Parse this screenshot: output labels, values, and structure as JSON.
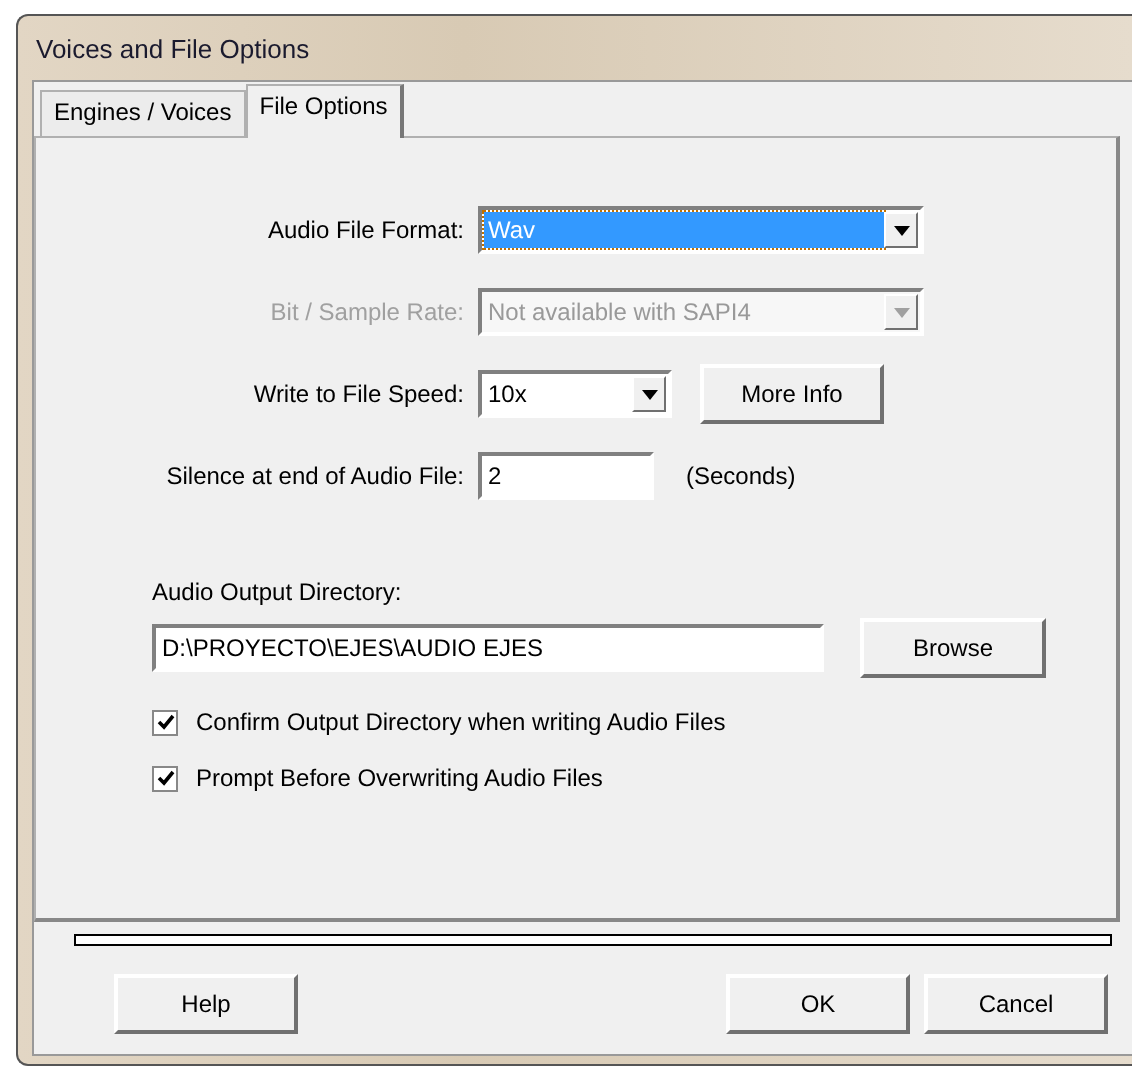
{
  "window": {
    "title": "Voices and File Options"
  },
  "tabs": [
    {
      "label": "Engines / Voices",
      "selected": false
    },
    {
      "label": "File Options",
      "selected": true
    }
  ],
  "form": [
    {
      "kind": "combo",
      "label": "Audio File Format:",
      "value": "Wav",
      "disabled": false,
      "focused": true
    },
    {
      "kind": "combo",
      "label": "Bit / Sample Rate:",
      "value": "Not available with SAPI4",
      "disabled": true,
      "focused": false
    },
    {
      "kind": "combo-button",
      "label": "Write to File Speed:",
      "value": "10x",
      "disabled": false,
      "focused": false,
      "button": "More Info"
    },
    {
      "kind": "field",
      "label": "Silence at end of Audio File:",
      "value": "2",
      "disabled": false,
      "focused": false,
      "suffix": "(Seconds)"
    }
  ],
  "output_directory": {
    "label": "Audio Output Directory:",
    "value": "D:\\PROYECTO\\EJES\\AUDIO EJES",
    "button": "Browse"
  },
  "checkboxes": [
    {
      "label": "Confirm Output Directory when writing Audio Files",
      "checked": true
    },
    {
      "label": "Prompt Before Overwriting Audio Files",
      "checked": true
    }
  ],
  "progress": {
    "level": 0
  },
  "buttons": [
    {
      "label": "Help",
      "kind": "left"
    },
    {
      "label": "OK",
      "kind": "right"
    },
    {
      "label": "Cancel",
      "kind": "right"
    }
  ]
}
